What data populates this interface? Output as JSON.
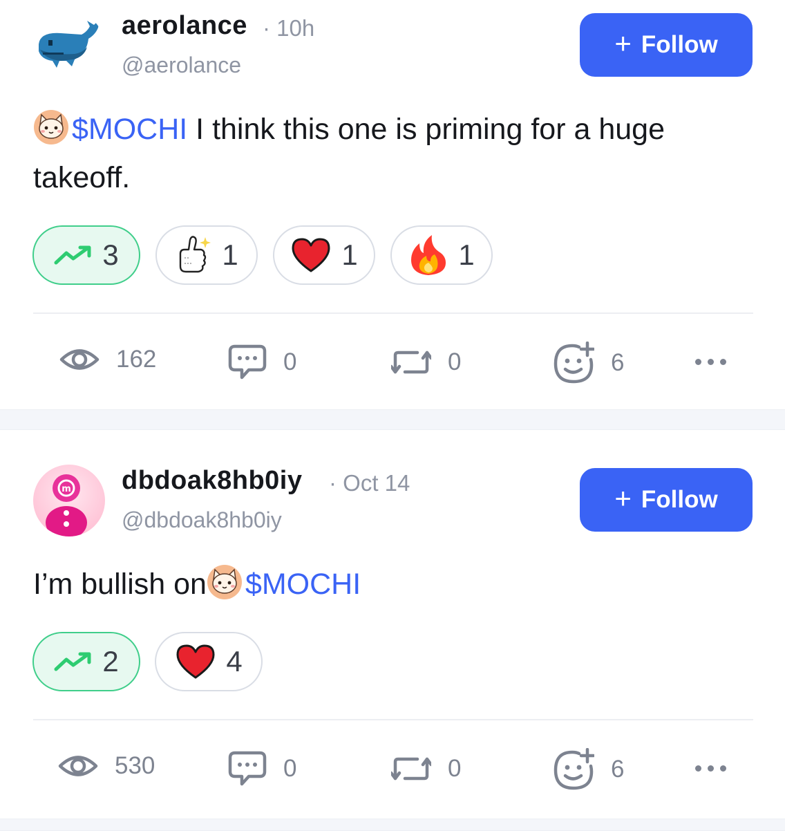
{
  "posts": [
    {
      "author": "aerolance",
      "time": "· 10h",
      "handle": "@aerolance",
      "follow_label": "Follow",
      "text_prefix": "",
      "ticker": "$MOCHI",
      "text_suffix": " I think this one is priming for a huge takeoff.",
      "reactions": {
        "trending": "3",
        "thumbs": "1",
        "heart": "1",
        "fire": "1"
      },
      "stats": {
        "views": "162",
        "comments": "0",
        "reposts": "0",
        "emoji_reactions": "6"
      }
    },
    {
      "author": "dbdoak8hb0iy",
      "time": "· Oct 14",
      "handle": "@dbdoak8hb0iy",
      "follow_label": "Follow",
      "text_prefix": "I’m bullish on",
      "ticker": "$MOCHI",
      "text_suffix": "",
      "reactions": {
        "trending": "2",
        "heart": "4"
      },
      "stats": {
        "views": "530",
        "comments": "0",
        "reposts": "0",
        "emoji_reactions": "6"
      }
    }
  ],
  "icons": {
    "views": "eye-icon",
    "comments": "comment-icon",
    "reposts": "repost-icon",
    "react": "add-reaction-icon",
    "more": "more-dots-icon",
    "trending": "trending-up-icon",
    "thumbs": "thumbs-up-icon",
    "heart": "heart-icon",
    "fire": "fire-icon",
    "coin": "mochi-cat-icon"
  },
  "colors": {
    "accent": "#3a63f5",
    "trend_green": "#2ecc71",
    "muted": "#8f95a3"
  }
}
